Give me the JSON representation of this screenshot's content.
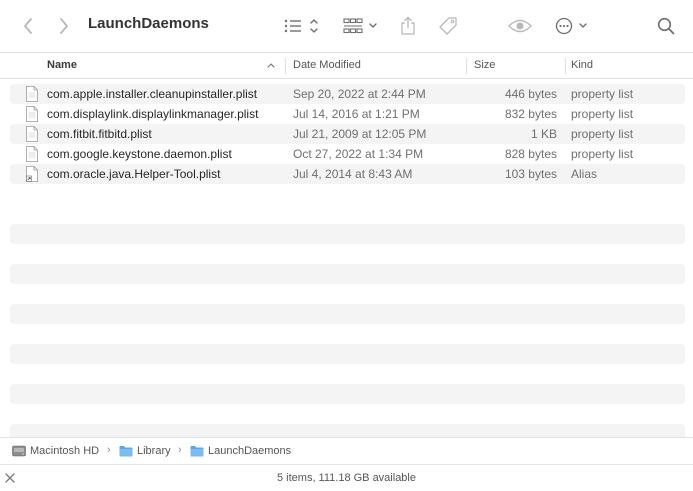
{
  "toolbar": {
    "title": "LaunchDaemons",
    "icons": [
      "chevron-left-icon",
      "chevron-right-icon",
      "list-view-icon",
      "grid-view-icon",
      "share-icon",
      "tag-icon",
      "quicklook-eye-icon",
      "more-actions-icon",
      "search-icon"
    ]
  },
  "columns": {
    "name": "Name",
    "date": "Date Modified",
    "size": "Size",
    "kind": "Kind"
  },
  "files": [
    {
      "name": "com.apple.installer.cleanupinstaller.plist",
      "date": "Sep 20, 2022 at 2:44 PM",
      "size": "446 bytes",
      "kind": "property list",
      "icon": "plist-file-icon"
    },
    {
      "name": "com.displaylink.displaylinkmanager.plist",
      "date": "Jul 14, 2016 at 1:21 PM",
      "size": "832 bytes",
      "kind": "property list",
      "icon": "plist-file-icon"
    },
    {
      "name": "com.fitbit.fitbitd.plist",
      "date": "Jul 21, 2009 at 12:05 PM",
      "size": "1 KB",
      "kind": "property list",
      "icon": "plist-file-icon"
    },
    {
      "name": "com.google.keystone.daemon.plist",
      "date": "Oct 27, 2022 at 1:34 PM",
      "size": "828 bytes",
      "kind": "property list",
      "icon": "plist-file-icon"
    },
    {
      "name": "com.oracle.java.Helper-Tool.plist",
      "date": "Jul 4, 2014 at 8:43 AM",
      "size": "103 bytes",
      "kind": "Alias",
      "icon": "alias-file-icon"
    }
  ],
  "pathbar": {
    "crumbs": [
      "Macintosh HD",
      "Library",
      "LaunchDaemons"
    ],
    "separator": "›"
  },
  "status": {
    "text": "5 items, 111.18 GB available"
  },
  "colors": {
    "folder": "#5aa9e6",
    "stripe": "#f4f4f4",
    "divider": "#e3e3e3"
  }
}
